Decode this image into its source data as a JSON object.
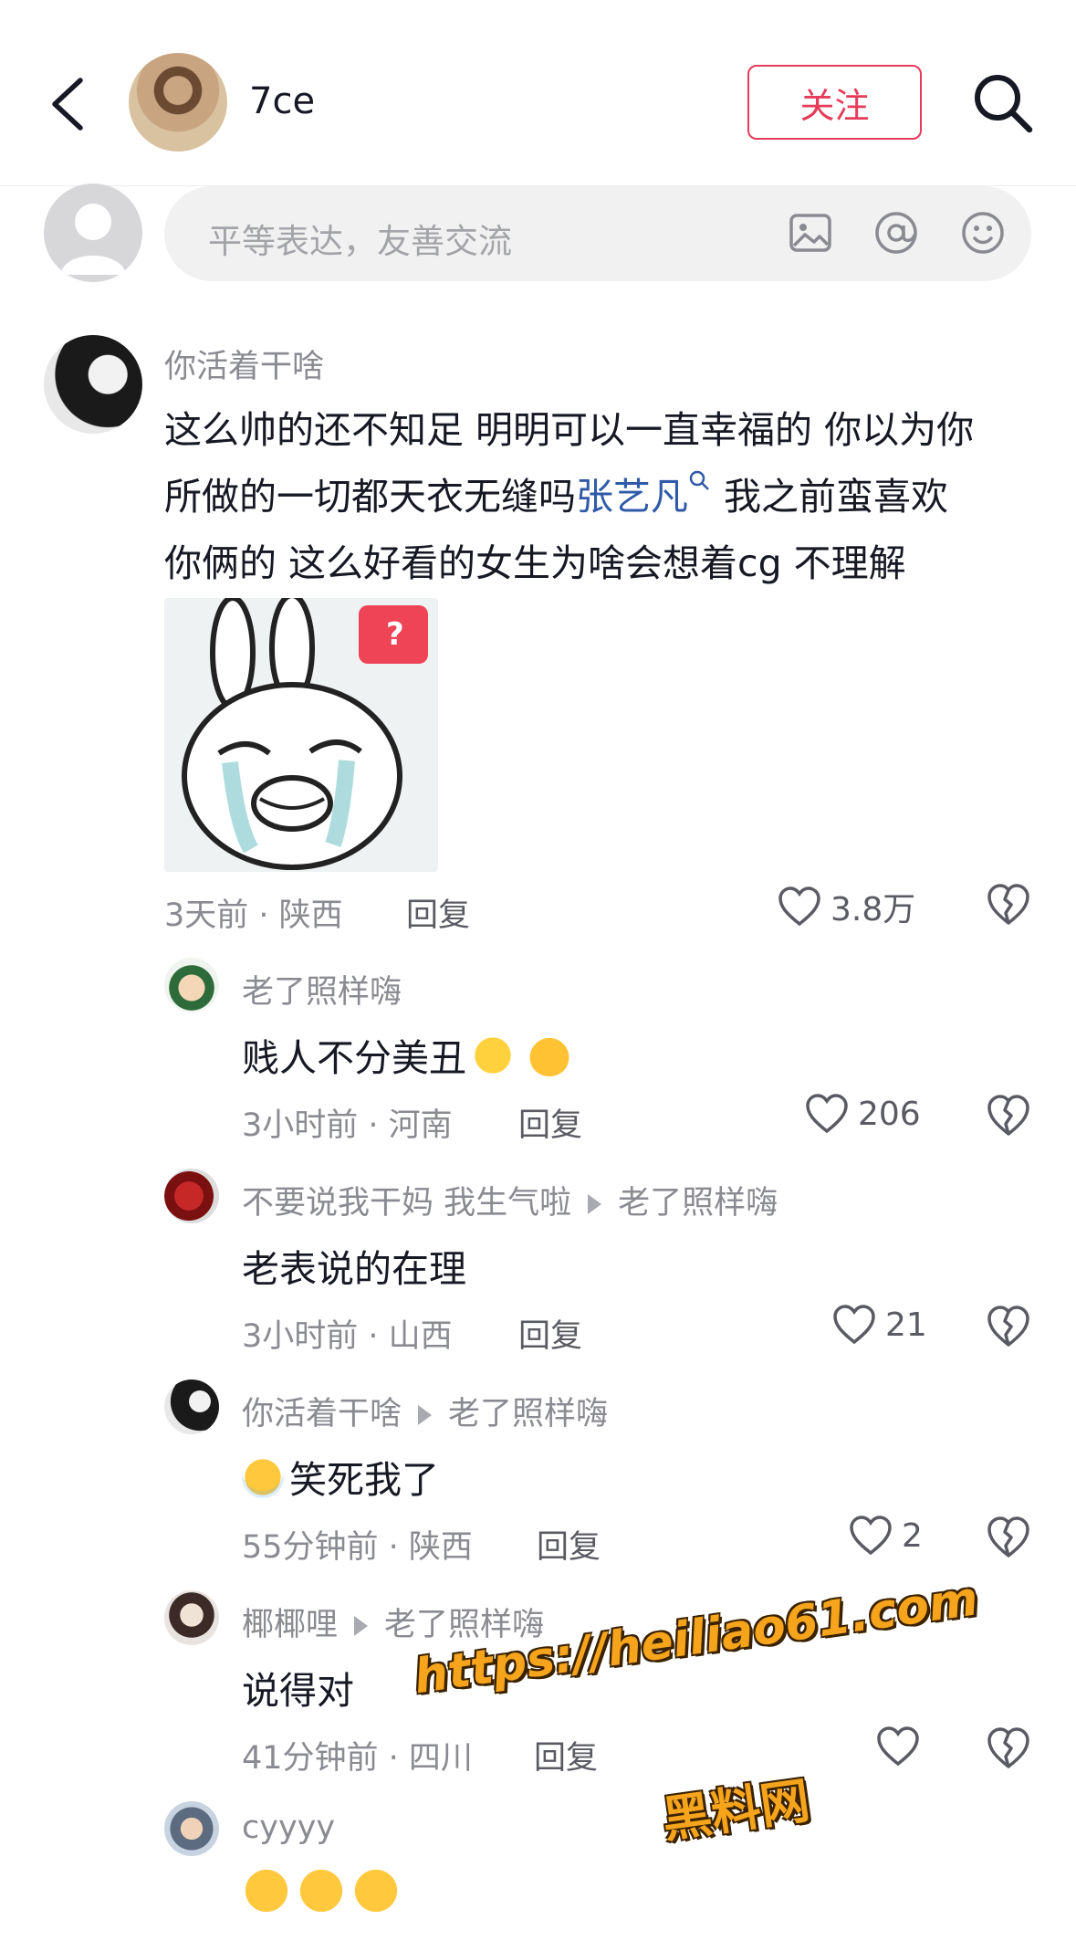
{
  "header": {
    "name": "7ce",
    "follow_label": "关注",
    "icons": [
      "back-icon",
      "search-icon"
    ]
  },
  "input": {
    "placeholder": "平等表达，友善交流",
    "icons": [
      "image-icon",
      "at-icon",
      "emoji-icon"
    ]
  },
  "colors": {
    "accent": "#e63b5a",
    "link": "#2f5aa8",
    "watermark": "#f5a41c"
  },
  "main_comment": {
    "user": "你活着干啥",
    "line1": "这么帅的还不知足 明明可以一直幸福的 你以为你",
    "line2_a": "所做的一切都天衣无缝吗",
    "line2_link": "张艺凡",
    "line2_b": " 我之前蛮喜欢",
    "line3": "你俩的 这么好看的女生为啥会想着cg 不理解",
    "sticker_badge": "?",
    "meta": "3天前 · 陕西",
    "reply": "回复",
    "likes": "3.8万"
  },
  "replies": [
    {
      "user": "老了照样嗨",
      "to": "",
      "text": "贱人不分美丑",
      "emojis": [
        "finger-heart-emoji",
        "thumbs-up-emoji"
      ],
      "meta": "3小时前 · 河南",
      "reply": "回复",
      "likes": "206"
    },
    {
      "user": "不要说我干妈 我生气啦",
      "to": "老了照样嗨",
      "text": "老表说的在理",
      "emojis": [],
      "meta": "3小时前 · 山西",
      "reply": "回复",
      "likes": "21"
    },
    {
      "user": "你活着干啥",
      "to": "老了照样嗨",
      "text": "笑死我了",
      "emojis": [
        "crying-laugh-emoji"
      ],
      "meta": "55分钟前 · 陕西",
      "reply": "回复",
      "likes": "2"
    },
    {
      "user": "椰椰哩",
      "to": "老了照样嗨",
      "text": "说得对",
      "emojis": [],
      "meta": "41分钟前 · 四川",
      "reply": "回复",
      "likes": ""
    },
    {
      "user": "cyyyy",
      "to": "",
      "text": "",
      "emojis": [
        "crying-laugh-emoji",
        "crying-laugh-emoji",
        "crying-laugh-emoji"
      ],
      "meta": "",
      "reply": "",
      "likes": ""
    }
  ],
  "watermark": {
    "url": "https://heiliao61.com",
    "name": "黑料网"
  }
}
